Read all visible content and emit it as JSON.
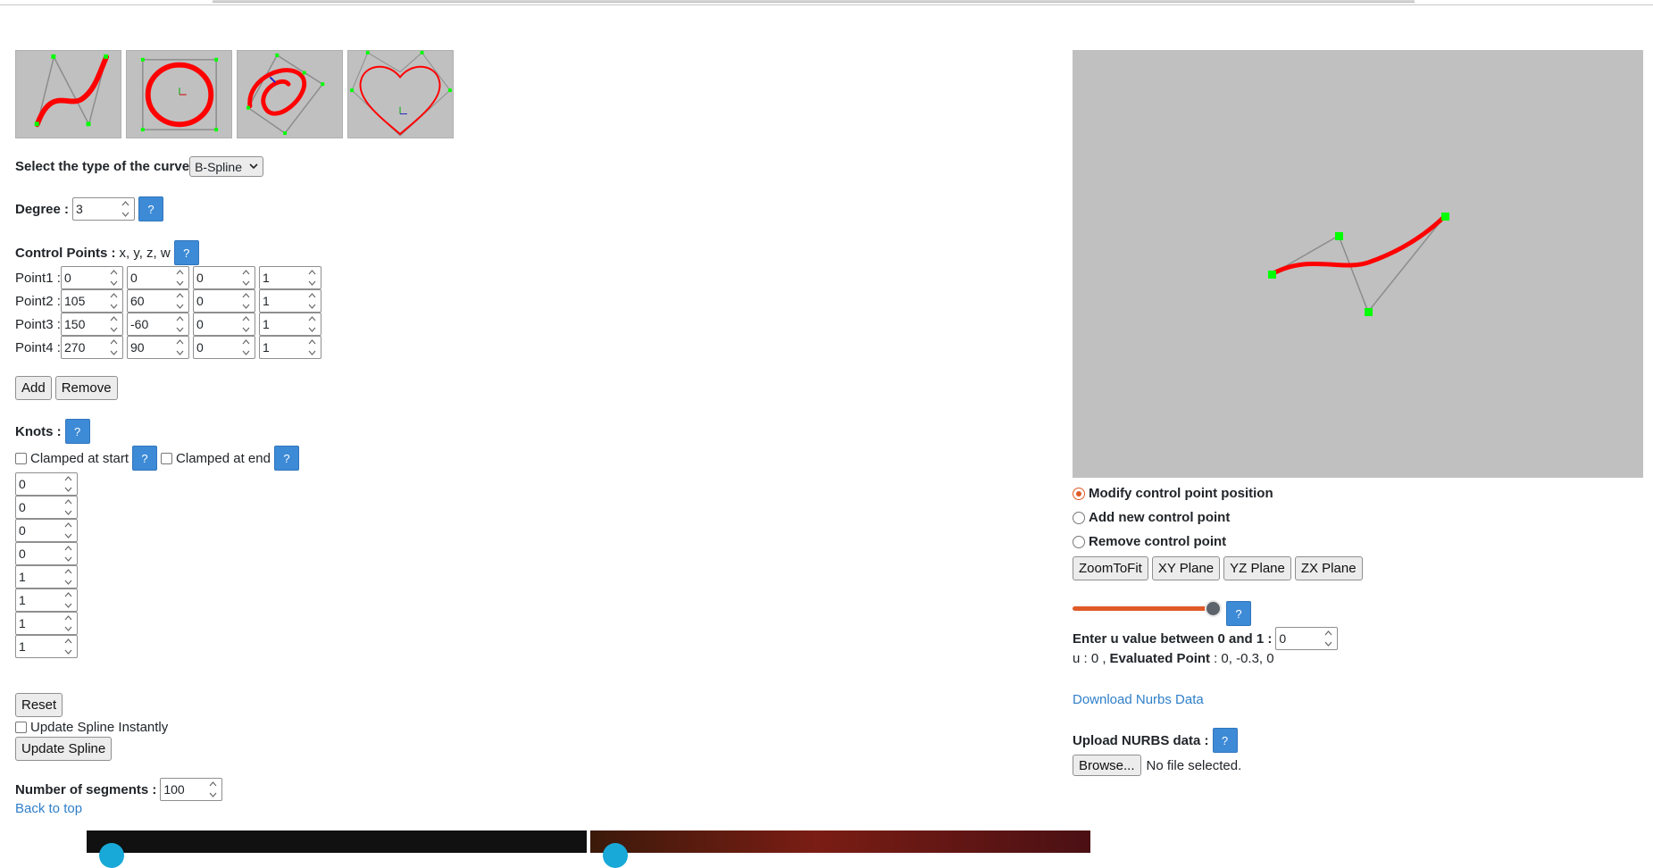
{
  "presets": [
    {
      "name": "s-curve"
    },
    {
      "name": "circle"
    },
    {
      "name": "spiral"
    },
    {
      "name": "heart"
    }
  ],
  "curve_type": {
    "label": "Select the type of the curve",
    "selected": "B-Spline"
  },
  "degree": {
    "label": "Degree :",
    "value": "3",
    "help": "?"
  },
  "control_points": {
    "label": "Control Points :",
    "hint": "x, y, z, w",
    "help": "?",
    "rows": [
      {
        "label": "Point1 :",
        "x": "0",
        "y": "0",
        "z": "0",
        "w": "1"
      },
      {
        "label": "Point2 :",
        "x": "105",
        "y": "60",
        "z": "0",
        "w": "1"
      },
      {
        "label": "Point3 :",
        "x": "150",
        "y": "-60",
        "z": "0",
        "w": "1"
      },
      {
        "label": "Point4 :",
        "x": "270",
        "y": "90",
        "z": "0",
        "w": "1"
      }
    ]
  },
  "buttons": {
    "add": "Add",
    "remove": "Remove",
    "reset": "Reset",
    "update": "Update Spline"
  },
  "knots": {
    "label": "Knots :",
    "help": "?",
    "clamped_start": "Clamped at start",
    "clamped_end": "Clamped at end",
    "values": [
      "0",
      "0",
      "0",
      "0",
      "1",
      "1",
      "1",
      "1"
    ]
  },
  "update_instantly": "Update Spline Instantly",
  "segments": {
    "label": "Number of segments :",
    "value": "100"
  },
  "back_to_top": "Back to top",
  "modes": [
    {
      "label": "Modify control point position",
      "selected": true
    },
    {
      "label": "Add new control point",
      "selected": false
    },
    {
      "label": "Remove control point",
      "selected": false
    }
  ],
  "view_buttons": [
    "ZoomToFit",
    "XY Plane",
    "YZ Plane",
    "ZX Plane"
  ],
  "u_slider": {
    "value": 1,
    "help": "?"
  },
  "u_input": {
    "label": "Enter u value between 0 and 1 :",
    "value": "0"
  },
  "evaluated": {
    "prefix": "u : 0 ,",
    "label": "Evaluated Point",
    "value": ": 0, -0.3, 0"
  },
  "download": "Download Nurbs Data",
  "upload": {
    "label": "Upload NURBS data :",
    "help": "?",
    "browse": "Browse...",
    "status": "No file selected."
  },
  "colors": {
    "accent": "#e05a28",
    "help": "#3d8ad6",
    "viewport": "#c0c0c0",
    "curve": "#ff0000",
    "control": "#00ff00"
  }
}
